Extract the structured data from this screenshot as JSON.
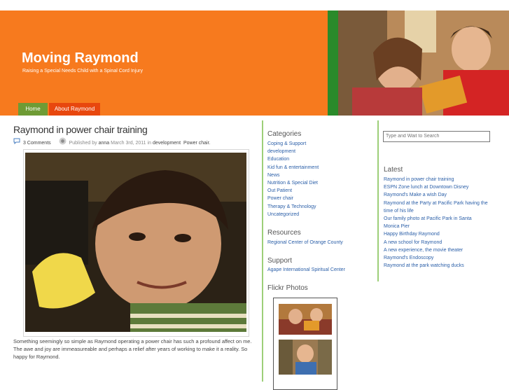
{
  "site": {
    "title": "Moving Raymond",
    "tagline": "Raising a Special Needs Child with a Spinal Cord Injury"
  },
  "nav": [
    {
      "label": "Home"
    },
    {
      "label": "About Raymond"
    }
  ],
  "post": {
    "title": "Raymond in power chair training",
    "comments": "3 Comments",
    "published_prefix": "Published by",
    "author": "anna",
    "date": "March 3rd, 2011 in",
    "cat1": "development",
    "cat2": "Power chair.",
    "body": "Something seemingly so simple as Raymond operating a power chair has such a profound affect on me.  The awe and joy are immeasureable and perhaps a relief after years of working to make it a reality.  So happy for Raymond."
  },
  "sidebar": {
    "categories_heading": "Categories",
    "categories": [
      "Coping & Support",
      "development",
      "Education",
      "Kid fun & entertainment",
      "News",
      "Nutrition & Special Diet",
      "Out Patient",
      "Power chair",
      "Therapy & Technology",
      "Uncategorized"
    ],
    "resources_heading": "Resources",
    "resources": [
      "Regional Center of Orange County"
    ],
    "support_heading": "Support",
    "support": [
      "Agape International Spiritual Center"
    ],
    "flickr_heading": "Flickr Photos"
  },
  "search": {
    "placeholder": "Type and Wait to Search"
  },
  "latest": {
    "heading": "Latest",
    "items": [
      "Raymond in power chair training",
      "ESPN Zone lunch at Downtown Disney",
      "Raymond's Make a wish Day",
      "Raymond at the Party at Pacific Park having the time of his life",
      "Our family photo at Pacific Park in Santa Monica Pier",
      "Happy Birthday Raymond",
      "A new school for Raymond",
      "A new experience, the movie theater",
      "Raymond's Endoscopy",
      "Raymond at the park watching ducks"
    ]
  },
  "colors": {
    "header_orange": "#f77a1e",
    "nav_home": "#6e9b35",
    "nav_about": "#e8470e",
    "link_blue": "#2b5fa8",
    "divider_green": "#9dcf78"
  }
}
